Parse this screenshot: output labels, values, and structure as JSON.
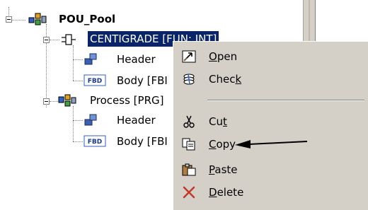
{
  "tree": {
    "root": {
      "label": "POU_Pool"
    },
    "items": [
      {
        "label": "CENTIGRADE [FUN: INT]"
      },
      {
        "label": "Header"
      },
      {
        "label": "Body [FBI"
      },
      {
        "label": "Process [PRG]"
      },
      {
        "label": "Header"
      },
      {
        "label": "Body [FBI"
      }
    ],
    "fbd_badge": "FBD"
  },
  "context_menu": {
    "items": [
      {
        "pre": "",
        "mnemonic": "O",
        "post": "pen",
        "icon": "open-icon"
      },
      {
        "pre": "Chec",
        "mnemonic": "k",
        "post": "",
        "icon": "check-icon"
      },
      {
        "pre": "Cu",
        "mnemonic": "t",
        "post": "",
        "icon": "cut-icon"
      },
      {
        "pre": "",
        "mnemonic": "C",
        "post": "opy",
        "icon": "copy-icon"
      },
      {
        "pre": "",
        "mnemonic": "P",
        "post": "aste",
        "icon": "paste-icon"
      },
      {
        "pre": "",
        "mnemonic": "D",
        "post": "elete",
        "icon": "delete-icon"
      }
    ]
  },
  "colors": {
    "selection": "#0a246a",
    "menu_background": "#d4d0c8",
    "delete_icon": "#c0392b"
  }
}
